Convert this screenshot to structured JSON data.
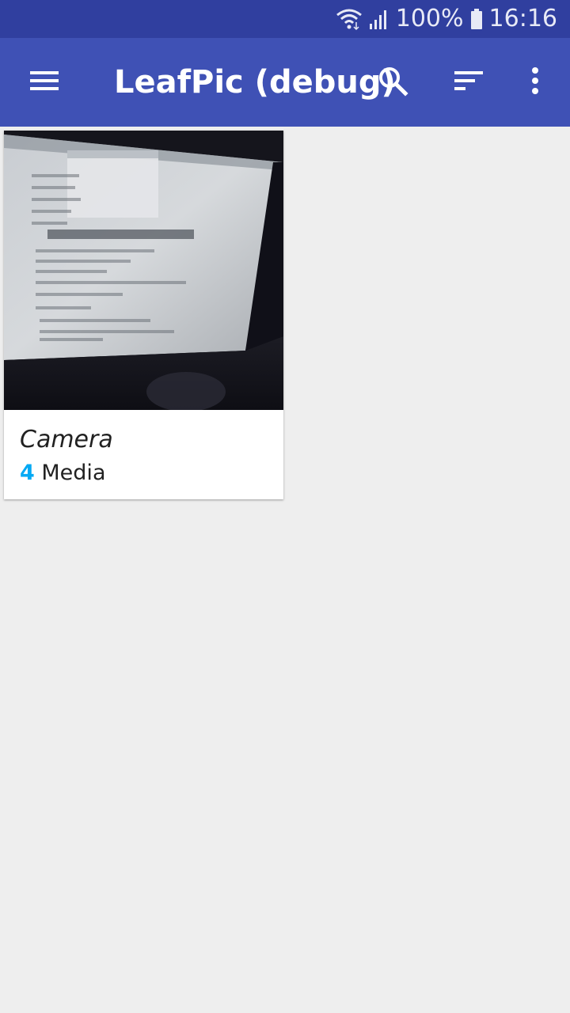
{
  "status_bar": {
    "battery": "100%",
    "time": "16:16",
    "icons": [
      "wifi-icon",
      "signal-icon",
      "battery-icon"
    ]
  },
  "app_bar": {
    "title": "LeafPic (debug)",
    "icons": [
      "menu-icon",
      "search-icon",
      "sort-icon",
      "more-vert-icon"
    ]
  },
  "albums": [
    {
      "name": "Camera",
      "count": "4",
      "count_label": "Media"
    }
  ],
  "colors": {
    "status_bar": "#303f9f",
    "app_bar": "#3f51b5",
    "background": "#eeeeee",
    "count_accent": "#03a9f4"
  }
}
